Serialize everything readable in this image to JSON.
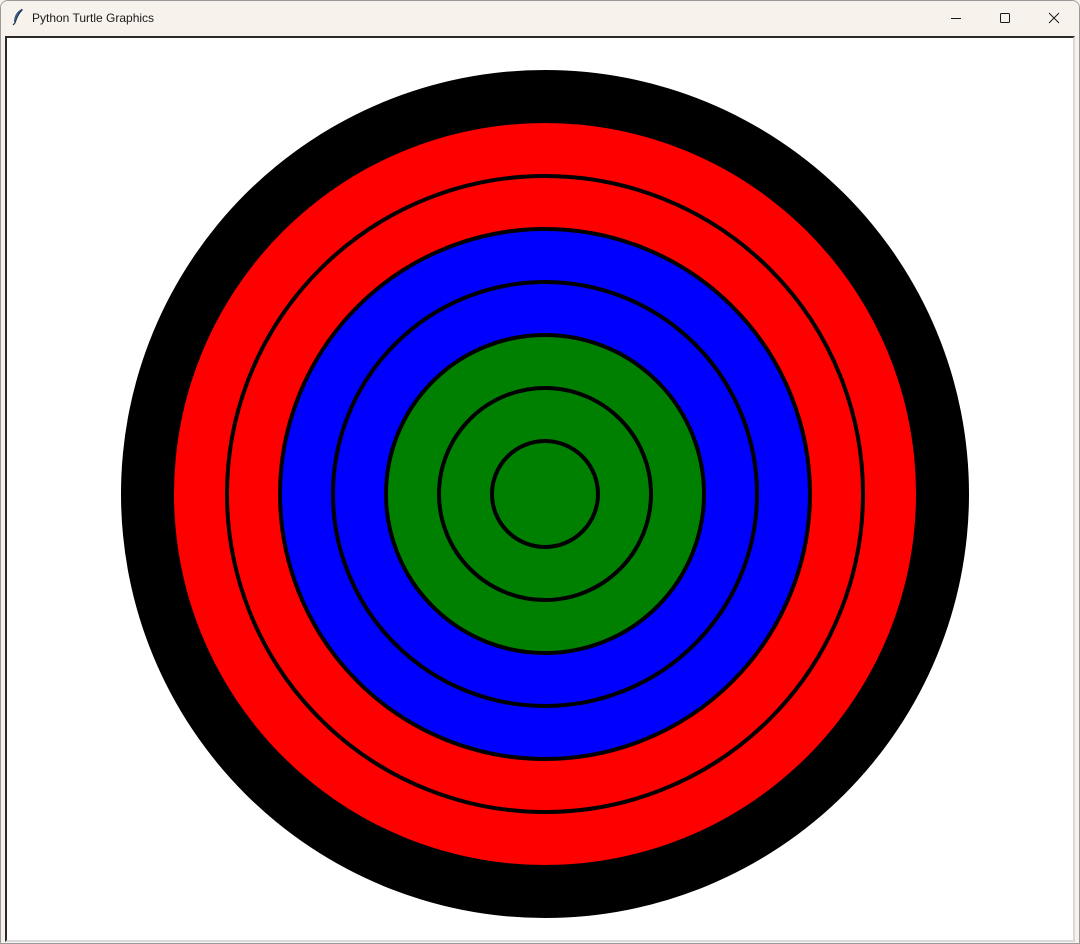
{
  "window": {
    "title": "Python Turtle Graphics",
    "app_icon": "feather-icon",
    "controls": {
      "minimize_icon": "minimize-icon",
      "maximize_icon": "maximize-icon",
      "close_icon": "close-icon"
    }
  },
  "canvas": {
    "background": "#ffffff",
    "rings": [
      {
        "fill": "#000000",
        "outline": false
      },
      {
        "fill": "#ff0000",
        "outline": false
      },
      {
        "fill": "#ff0000",
        "outline": true
      },
      {
        "fill": "#0000ff",
        "outline": true
      },
      {
        "fill": "#0000ff",
        "outline": true
      },
      {
        "fill": "#008000",
        "outline": true
      },
      {
        "fill": "#008000",
        "outline": true
      },
      {
        "fill": "#008000",
        "outline": true
      }
    ],
    "outline_color": "#000000"
  }
}
